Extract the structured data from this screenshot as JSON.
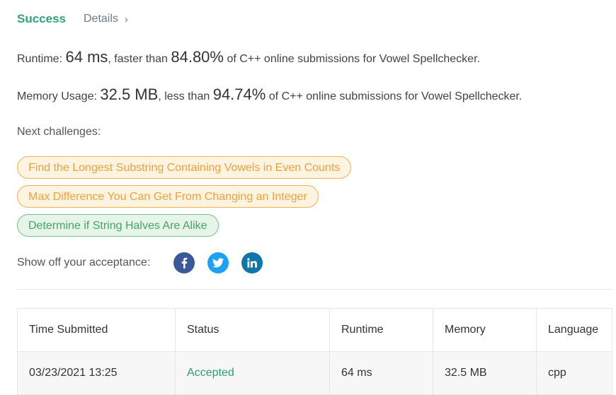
{
  "tabs": {
    "success": "Success",
    "details": "Details",
    "details_chevron": "›"
  },
  "runtime": {
    "label": "Runtime:",
    "value": "64 ms",
    "mid": ", faster than",
    "percent": "84.80%",
    "suffix": "of C++ online submissions for Vowel Spellchecker."
  },
  "memory": {
    "label": "Memory Usage:",
    "value": "32.5 MB",
    "mid": ", less than",
    "percent": "94.74%",
    "suffix": "of C++ online submissions for Vowel Spellchecker."
  },
  "next_challenges": {
    "label": "Next challenges:",
    "items": [
      {
        "title": "Find the Longest Substring Containing Vowels in Even Counts",
        "difficulty": "medium"
      },
      {
        "title": "Max Difference You Can Get From Changing an Integer",
        "difficulty": "medium"
      },
      {
        "title": "Determine if String Halves Are Alike",
        "difficulty": "easy"
      }
    ]
  },
  "share": {
    "label": "Show off your acceptance:",
    "icons": [
      "facebook-icon",
      "twitter-icon",
      "linkedin-icon"
    ]
  },
  "submissions": {
    "headers": [
      "Time Submitted",
      "Status",
      "Runtime",
      "Memory",
      "Language"
    ],
    "rows": [
      {
        "time": "03/23/2021 13:25",
        "status": "Accepted",
        "runtime": "64 ms",
        "memory": "32.5 MB",
        "language": "cpp"
      }
    ]
  },
  "colors": {
    "success": "#32a07a",
    "medium": "#f0a23a",
    "easy": "#43a662",
    "facebook": "#3b5998",
    "twitter": "#1da1f2",
    "linkedin": "#0e76a8"
  }
}
